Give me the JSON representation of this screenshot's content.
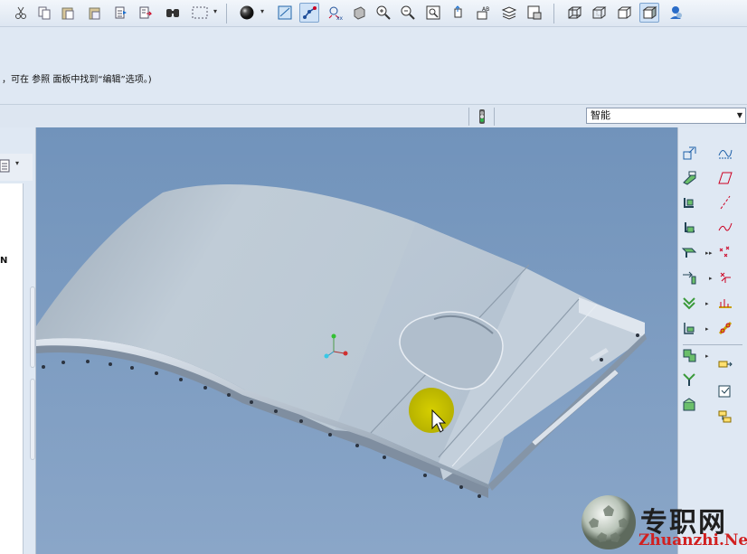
{
  "toolbar": {
    "icons": [
      "cut-icon",
      "copy-icon",
      "paste-icon",
      "paste-special-icon",
      "regenerate-icon",
      "regenerate-manager-icon",
      "find-icon",
      "select-box-icon",
      "shading-icon",
      "view-manager-icon",
      "datum-display-icon",
      "spin-center-icon",
      "zoom-in-icon",
      "zoom-out-icon",
      "refit-icon",
      "reorient-icon",
      "annotation-icon",
      "layers-icon",
      "appearance-icon",
      "wireframe-icon",
      "hidden-line-icon",
      "no-hidden-icon",
      "shaded-icon",
      "model-tree-icon"
    ],
    "active": [
      "datum-display-icon",
      "shaded-icon"
    ]
  },
  "message_area": {
    "text": "，可在 参照 面板中找到“编辑”选项。)"
  },
  "status": {
    "filter_value": "智能"
  },
  "left_panel": {
    "partial_label": "N"
  },
  "viewport": {
    "background": "#7e9dc1",
    "part_color": "#b8c6d3",
    "highlight_color": "#c8c400"
  },
  "right_toolbar": {
    "left_column": [
      "plane-icon",
      "axis-icon",
      "point-icon",
      "csys-icon",
      "sketch-icon",
      "extrude-icon",
      "revolve-icon",
      "sweep-icon",
      "blend-icon",
      "flange-icon",
      "bend-icon",
      "unbend-icon"
    ],
    "right_column": [
      "curve-icon",
      "plane-datum-icon",
      "axis-datum-icon",
      "sketched-curve-icon",
      "point-datum-icon",
      "offset-csys-icon",
      "analysis-icon",
      "edge-rip-icon",
      "convert-icon",
      "flatten-icon",
      "form-icon"
    ]
  },
  "watermark": {
    "cn_text": "专职网",
    "url_text": "Zhuanzhi.Net"
  }
}
